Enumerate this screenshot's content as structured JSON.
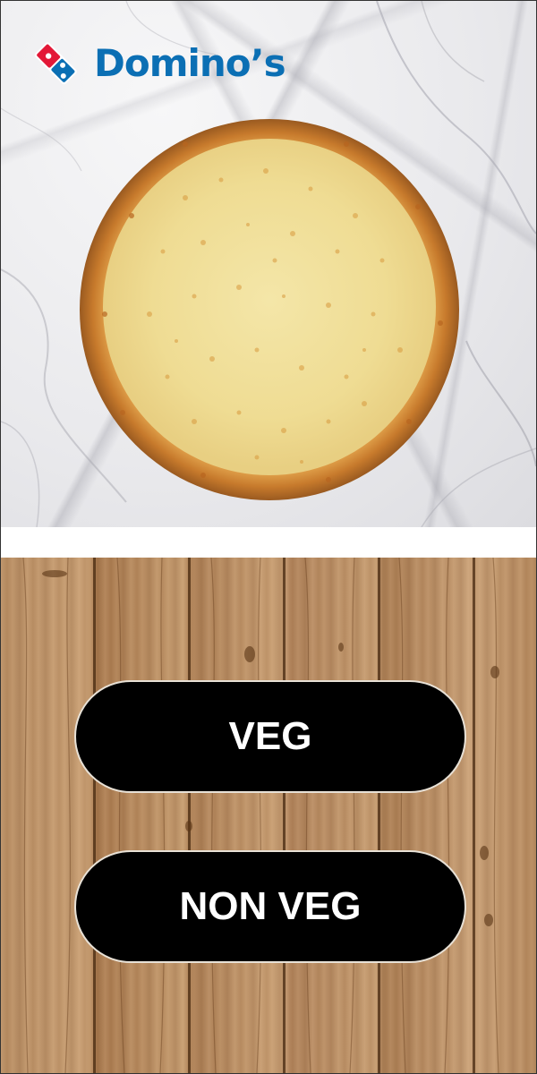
{
  "brand": {
    "name": "Domino’s",
    "text_color": "#0b6fb4",
    "mark_colors": {
      "blue": "#0b6fb4",
      "red": "#e31837",
      "white": "#ffffff"
    }
  },
  "hero": {
    "image": "cheese-pizza",
    "background": "white-marble"
  },
  "choices": {
    "veg_label": "VEG",
    "nonveg_label": "NON VEG",
    "button_color": "#000000",
    "text_color": "#ffffff"
  },
  "lower_background": "wood-planks"
}
